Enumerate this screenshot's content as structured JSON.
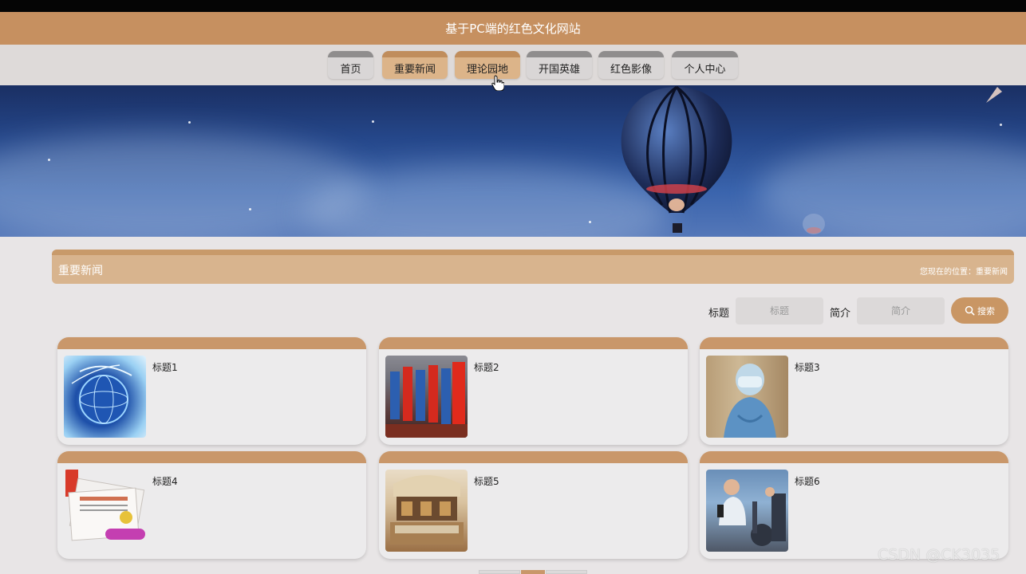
{
  "header": {
    "title": "基于PC端的红色文化网站"
  },
  "nav": [
    {
      "label": "首页"
    },
    {
      "label": "重要新闻"
    },
    {
      "label": "理论园地"
    },
    {
      "label": "开国英雄"
    },
    {
      "label": "红色影像"
    },
    {
      "label": "个人中心"
    }
  ],
  "section": {
    "title": "重要新闻",
    "breadcrumb": "您现在的位置：重要新闻"
  },
  "search": {
    "title_label": "标题",
    "title_placeholder": "标题",
    "intro_label": "简介",
    "intro_placeholder": "简介",
    "button_label": "搜索"
  },
  "cards": [
    {
      "title": "标题1"
    },
    {
      "title": "标题2"
    },
    {
      "title": "标题3"
    },
    {
      "title": "标题4"
    },
    {
      "title": "标题5"
    },
    {
      "title": "标题6"
    }
  ],
  "watermark": "CSDN @CK3035",
  "colors": {
    "accent": "#c69060",
    "nav_active": "#dcb489",
    "background": "#e8e5e6"
  }
}
